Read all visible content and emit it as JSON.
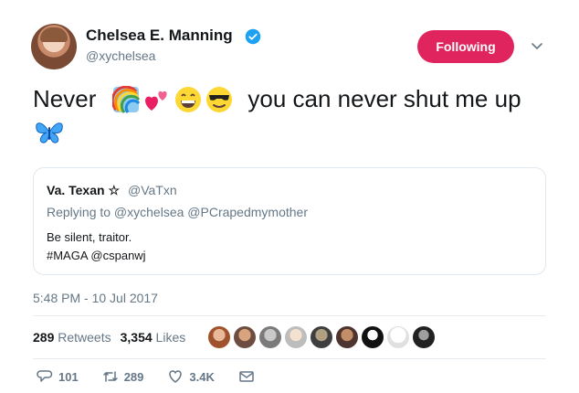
{
  "author": {
    "name": "Chelsea E. Manning",
    "handle": "@xychelsea",
    "verified": true
  },
  "follow_button": {
    "label": "Following",
    "color": "#e0245e"
  },
  "tweet": {
    "text_before": "Never",
    "emoji": [
      "rainbow-icon",
      "two-hearts-icon",
      "grinning-face-icon",
      "sunglasses-face-icon",
      "butterfly-icon"
    ],
    "text_after": "you can never shut me up"
  },
  "quoted_tweet": {
    "name": "Va. Texan ☆",
    "handle": "@VaTxn",
    "replying_to": "Replying to @xychelsea @PCrapedmymother",
    "line1": "Be silent, traitor.",
    "line2": "#MAGA @cspanwj"
  },
  "timestamp": "5:48 PM - 10 Jul 2017",
  "stats": {
    "retweets_count": "289",
    "retweets_label": "Retweets",
    "likes_count": "3,354",
    "likes_label": "Likes"
  },
  "actions": {
    "replies": "101",
    "retweets": "289",
    "likes": "3.4K"
  },
  "colors": {
    "accent": "#e0245e",
    "secondary_text": "#657786",
    "verified": "#1da1f2"
  }
}
